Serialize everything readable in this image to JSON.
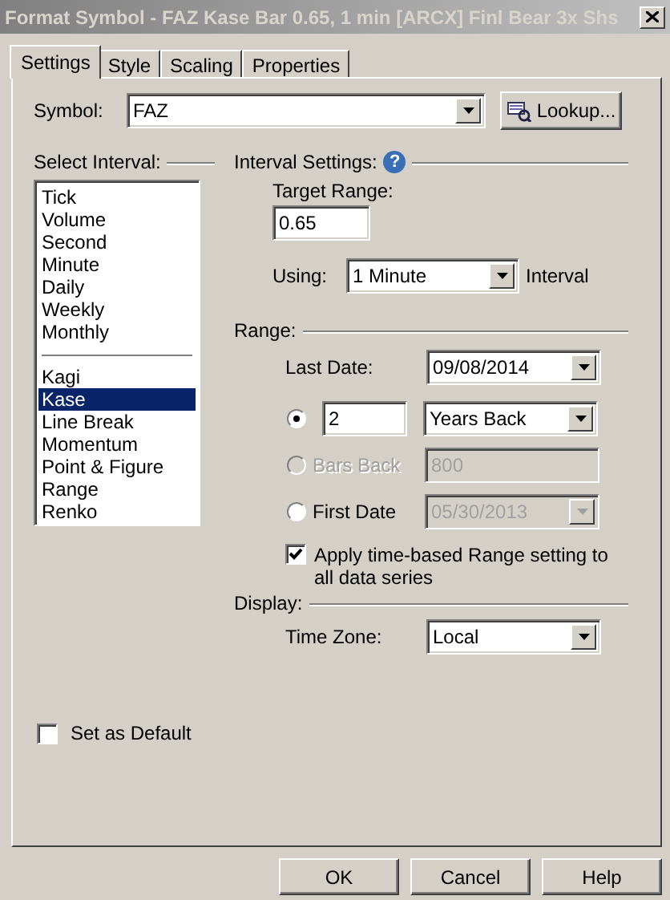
{
  "window": {
    "title": "Format Symbol - FAZ Kase Bar 0.65, 1 min [ARCX] Finl Bear 3x Shs"
  },
  "tabs": [
    {
      "label": "Settings",
      "selected": true
    },
    {
      "label": "Style",
      "selected": false
    },
    {
      "label": "Scaling",
      "selected": false
    },
    {
      "label": "Properties",
      "selected": false
    }
  ],
  "symbol": {
    "label": "Symbol:",
    "value": "FAZ",
    "lookup_button": "Lookup..."
  },
  "interval_list": {
    "heading": "Select Interval:",
    "groups": [
      [
        {
          "label": "Tick",
          "selected": false
        },
        {
          "label": "Volume",
          "selected": false
        },
        {
          "label": "Second",
          "selected": false
        },
        {
          "label": "Minute",
          "selected": false
        },
        {
          "label": "Daily",
          "selected": false
        },
        {
          "label": "Weekly",
          "selected": false
        },
        {
          "label": "Monthly",
          "selected": false
        }
      ],
      [
        {
          "label": "Kagi",
          "selected": false
        },
        {
          "label": "Kase",
          "selected": true
        },
        {
          "label": "Line Break",
          "selected": false
        },
        {
          "label": "Momentum",
          "selected": false
        },
        {
          "label": "Point & Figure",
          "selected": false
        },
        {
          "label": "Range",
          "selected": false
        },
        {
          "label": "Renko",
          "selected": false
        }
      ]
    ]
  },
  "interval_settings": {
    "heading": "Interval Settings:",
    "help_icon": "?",
    "target_range": {
      "label": "Target Range:",
      "value": "0.65"
    },
    "using": {
      "label": "Using:",
      "value": "1  Minute",
      "suffix": "Interval"
    }
  },
  "range": {
    "heading": "Range:",
    "last_date": {
      "label": "Last Date:",
      "value": "09/08/2014"
    },
    "options": [
      {
        "kind": "number_select",
        "selected": true,
        "disabled": false,
        "value": "2",
        "unit": "Years Back"
      },
      {
        "kind": "labeled_number",
        "selected": false,
        "disabled": true,
        "label": "Bars Back",
        "value": "800"
      },
      {
        "kind": "labeled_date",
        "selected": false,
        "disabled": false,
        "field_disabled": true,
        "label": "First Date",
        "value": "05/30/2013"
      }
    ],
    "apply_all": {
      "label": "Apply time-based Range setting to all data series",
      "checked": true
    }
  },
  "display": {
    "heading": "Display:",
    "time_zone": {
      "label": "Time Zone:",
      "value": "Local"
    }
  },
  "set_default": {
    "label": "Set as Default",
    "checked": false
  },
  "buttons": [
    "OK",
    "Cancel",
    "Help"
  ]
}
